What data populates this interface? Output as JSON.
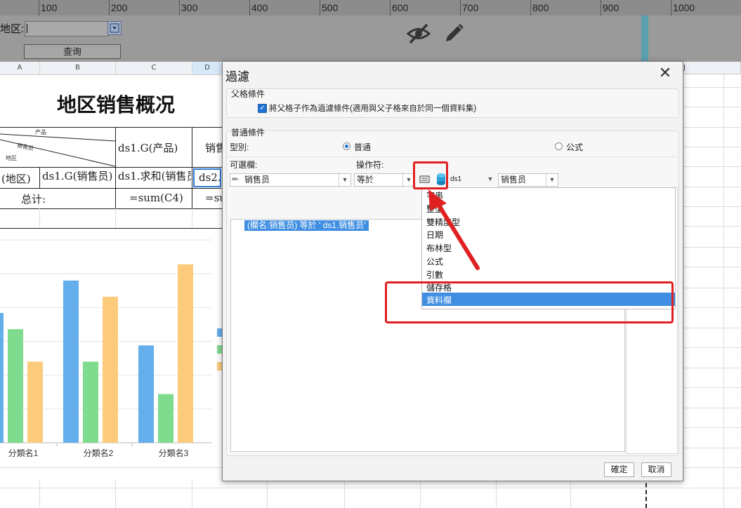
{
  "ruler": {
    "ticks": [
      "100",
      "200",
      "300",
      "400",
      "500",
      "600",
      "700",
      "800",
      "900",
      "1000"
    ]
  },
  "param_panel": {
    "region_label": "地区:",
    "query_button": "查询",
    "icons": {
      "visibility": "eye-off-icon",
      "edit": "pencil-icon"
    }
  },
  "sheet": {
    "columns": [
      "A",
      "B",
      "C",
      "D",
      "J"
    ],
    "title": "地区销售概况",
    "header_cell_labels": {
      "top": "产品",
      "middle": "销售员",
      "bottom": "地区"
    },
    "cells": {
      "c3": "ds1.G(产品)",
      "d3": "销售",
      "a4": "(地区)",
      "b4": "ds1.G(销售员)",
      "c4": "ds1.求和(销售员)",
      "d4": "ds2.",
      "a5": "总计:",
      "c5": "=sum(C4)",
      "d5": "=su"
    }
  },
  "chart_data": {
    "type": "bar",
    "categories": [
      "分類名1",
      "分類名2",
      "分類名3"
    ],
    "series": [
      {
        "color": "#64aeec",
        "values": [
          80,
          100,
          60
        ]
      },
      {
        "color": "#7fdb8e",
        "values": [
          70,
          50,
          30
        ]
      },
      {
        "color": "#fccb7c",
        "values": [
          50,
          90,
          110
        ]
      }
    ],
    "ylim": [
      0,
      125
    ],
    "grid": true,
    "legend": "right"
  },
  "dialog": {
    "title": "過濾",
    "parent_group": {
      "title": "父格條件",
      "checkbox_label": "將父格子作為過濾條件(適用與父子格來自於同一個資料集)",
      "checked": true
    },
    "normal_group": {
      "title": "普通條件",
      "type_label": "型別:",
      "type_options": [
        "普通",
        "公式"
      ],
      "selected_type": "普通",
      "optional_column_label": "可選欄:",
      "operator_label": "操作符:",
      "column_value": "销售员",
      "operator_value": "等於",
      "dataset_value": "ds1",
      "field_value": "销售员"
    },
    "condition_item": "(欄名:销售员) 等於 ' ds1.销售员'",
    "value_type_dropdown": {
      "options": [
        "字串",
        "整型",
        "雙精度型",
        "日期",
        "布林型",
        "公式",
        "引數",
        "儲存格",
        "資料欄"
      ],
      "selected": "資料欄"
    },
    "ok_button": "確定",
    "cancel_button": "取消"
  },
  "annotation_color": "#e02020"
}
